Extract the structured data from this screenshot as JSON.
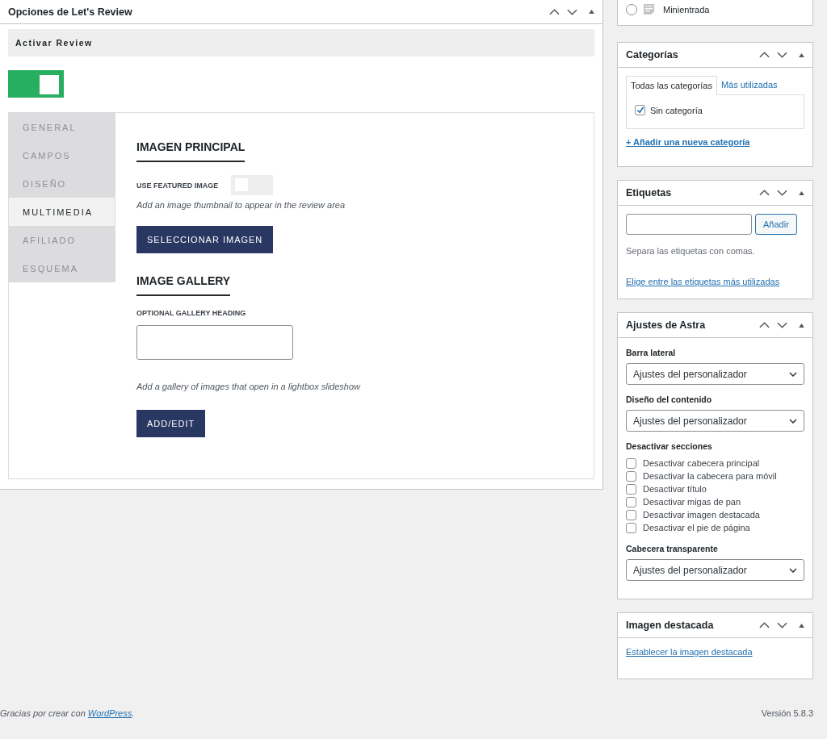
{
  "review_box": {
    "title": "Opciones de Let's Review",
    "activate_label": "Activar Review",
    "activate_on": true,
    "tabs": [
      {
        "label": "GENERAL",
        "selected": false
      },
      {
        "label": "CAMPOS",
        "selected": false
      },
      {
        "label": "DISEÑO",
        "selected": false
      },
      {
        "label": "MULTIMEDIA",
        "selected": true
      },
      {
        "label": "AFILIADO",
        "selected": false
      },
      {
        "label": "ESQUEMA",
        "selected": false
      }
    ],
    "sections": [
      {
        "kind": "image",
        "heading": "IMAGEN PRINCIPAL",
        "field_label": "USE FEATURED IMAGE",
        "toggle_on": false,
        "hint": "Add an image thumbnail to appear in the review area",
        "button": "SELECCIONAR IMAGEN"
      },
      {
        "kind": "gallery",
        "heading": "IMAGE GALLERY",
        "field_label": "OPTIONAL GALLERY HEADING",
        "hint": "Add a gallery of images that open in a lightbox slideshow",
        "button": "ADD/EDIT"
      }
    ]
  },
  "format_box": {
    "option": {
      "label": "Minientrada",
      "selected": false
    }
  },
  "categories": {
    "title": "Categorías",
    "tabs": [
      {
        "label": "Todas las categorías",
        "selected": true
      },
      {
        "label": "Más utilizadas",
        "selected": false
      }
    ],
    "items": [
      {
        "label": "Sin categoría",
        "checked": true
      }
    ],
    "add_link": "+ Añadir una nueva categoría"
  },
  "tags": {
    "title": "Etiquetas",
    "button": "Añadir",
    "hint": "Separa las etiquetas con comas.",
    "link": "Elige entre las etiquetas más utilizadas"
  },
  "astra": {
    "title": "Ajustes de Astra",
    "fields": [
      {
        "kind": "select",
        "label": "Barra lateral",
        "value": "Ajustes del personalizador"
      },
      {
        "kind": "select",
        "label": "Diseño del contenido",
        "value": "Ajustes del personalizador"
      },
      {
        "kind": "checklist",
        "label": "Desactivar secciones",
        "items": [
          {
            "label": "Desactivar cabecera principal",
            "checked": false
          },
          {
            "label": "Desactivar la cabecera para móvil",
            "checked": false
          },
          {
            "label": "Desactivar título",
            "checked": false
          },
          {
            "label": "Desactivar migas de pan",
            "checked": false
          },
          {
            "label": "Desactivar imagen destacada",
            "checked": false
          },
          {
            "label": "Desactivar el pie de página",
            "checked": false
          }
        ]
      },
      {
        "kind": "select",
        "label": "Cabecera transparente",
        "value": "Ajustes del personalizador"
      }
    ]
  },
  "featured_image": {
    "title": "Imagen destacada",
    "link": "Establecer la imagen destacada"
  },
  "footer": {
    "thanks": "Gracias por crear con ",
    "link": "WordPress",
    "end": ".",
    "version": "Versión 5.8.3"
  }
}
